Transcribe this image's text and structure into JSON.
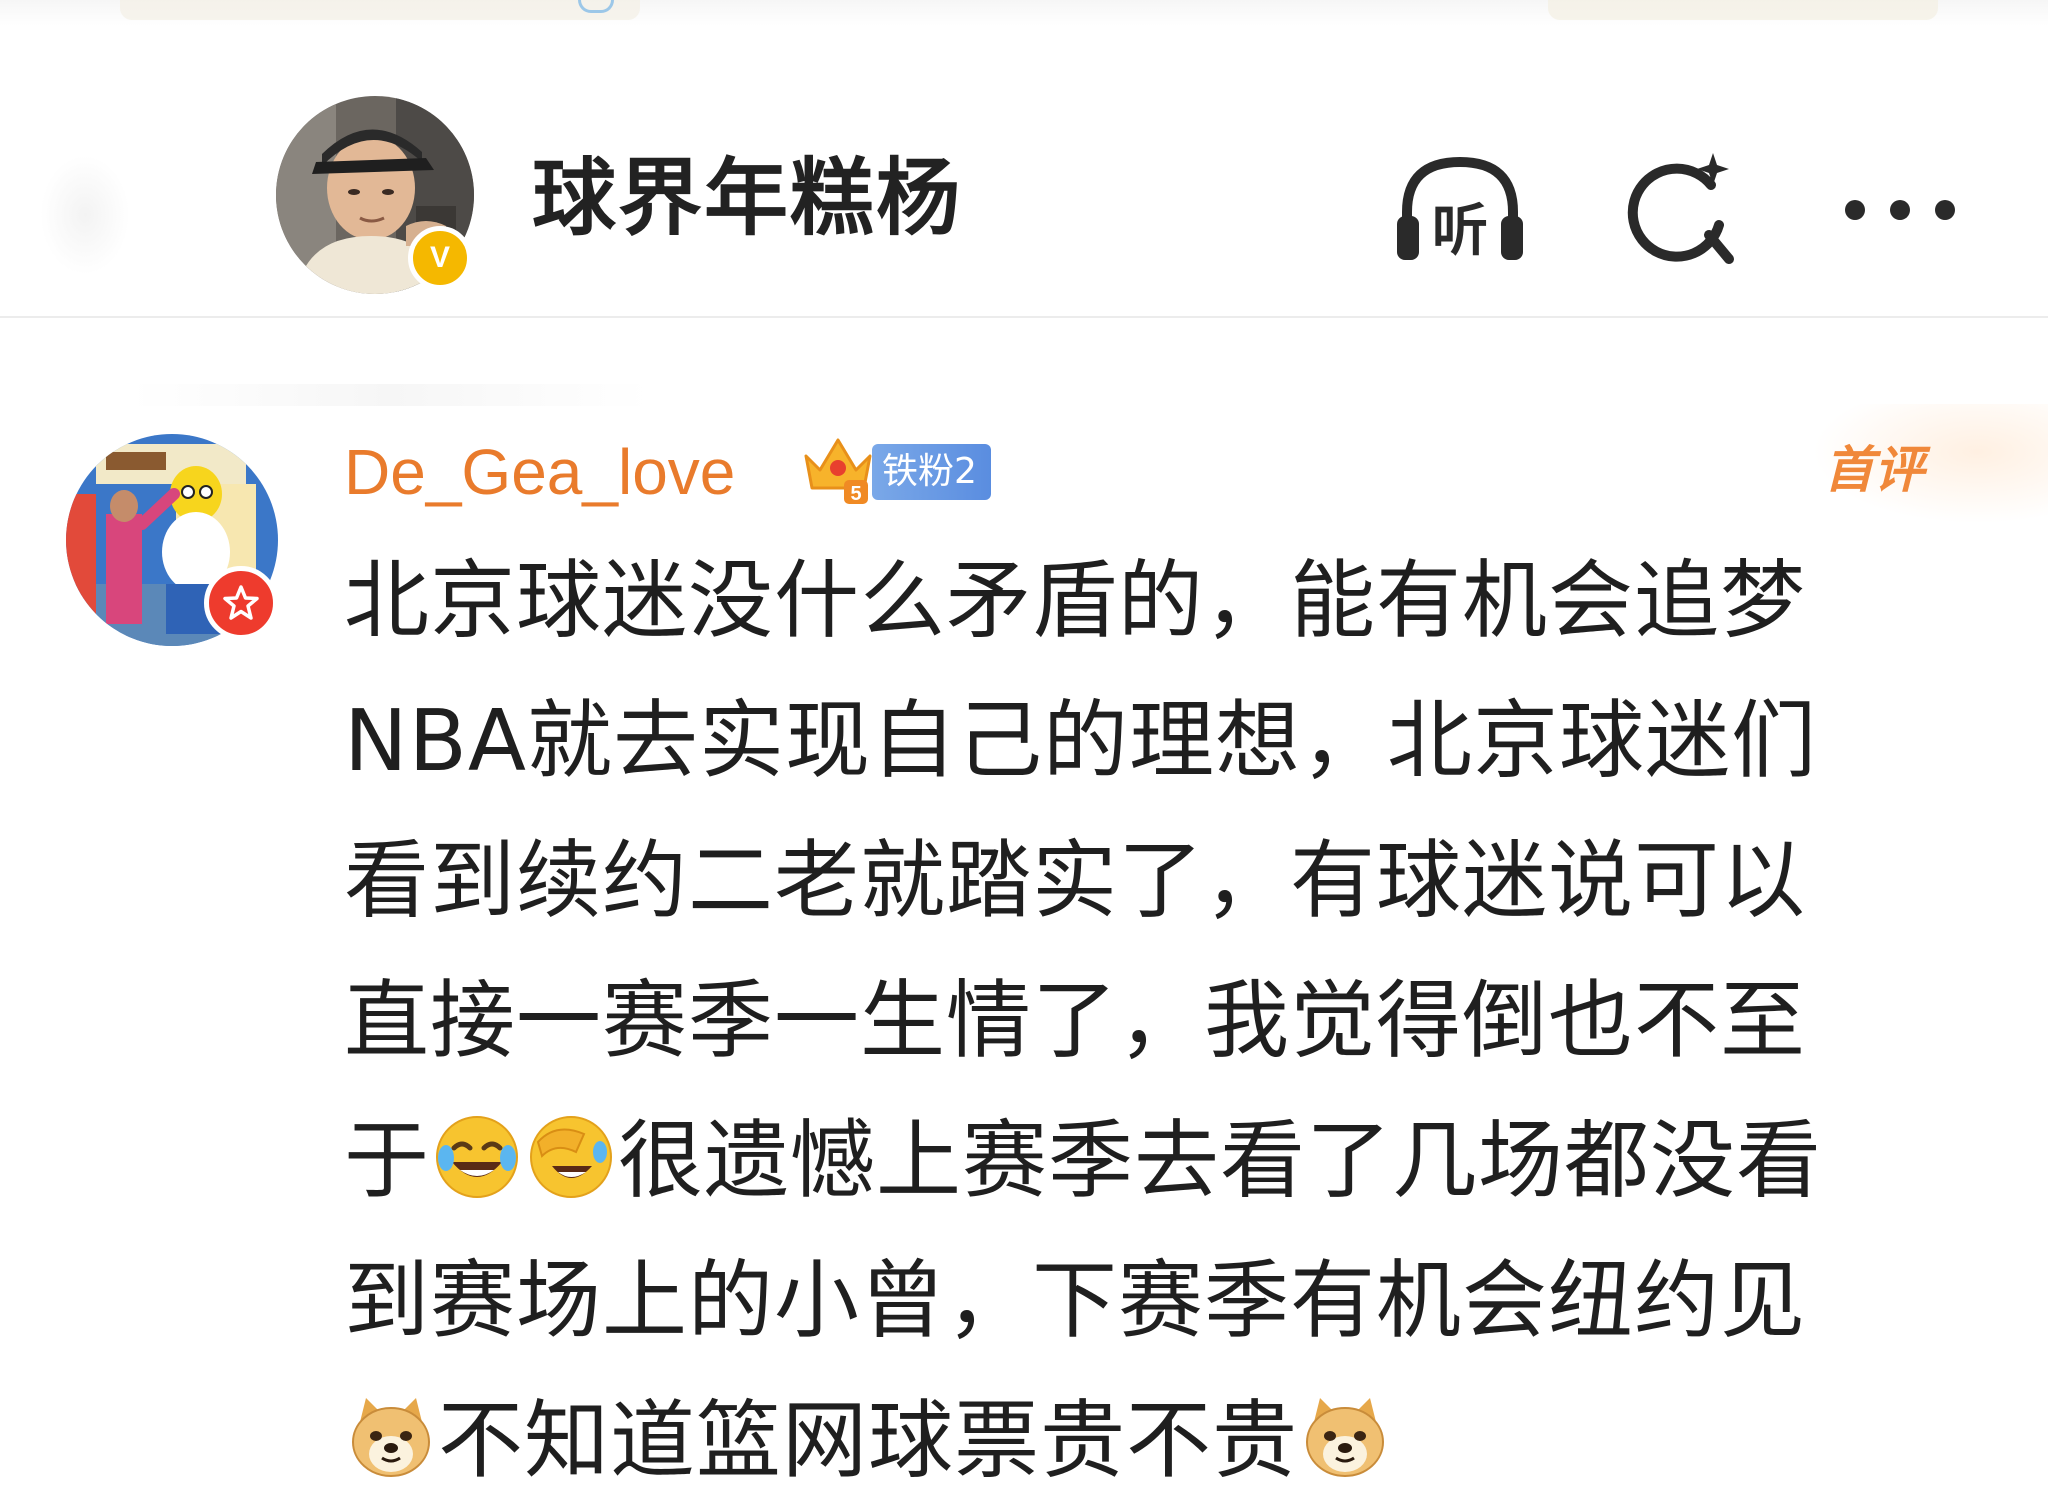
{
  "header": {
    "title": "球界年糕杨",
    "verified_mark": "V",
    "listen_label": "听",
    "icons": [
      "listen-icon",
      "search-icon",
      "more-icon"
    ]
  },
  "comment": {
    "username": "De_Gea_love",
    "crown_level": "5",
    "fan_badge": "铁粉2",
    "first_comment_tag": "首评",
    "lines": [
      [
        "北京球迷没什么矛盾的，能有机会追梦"
      ],
      [
        "NBA就去实现自己的理想，北京球迷们"
      ],
      [
        "看到续约二老就踏实了，有球迷说可以"
      ],
      [
        "直接一赛季一生情了，我觉得倒也不至"
      ],
      [
        "于",
        "很遗憾上赛季去看了几场都没看"
      ],
      [
        "到赛场上的小曾，下赛季有机会纽约见"
      ],
      [
        "不知道篮网球票贵不贵"
      ]
    ],
    "emojis": [
      "laughing-crying-emoji",
      "facepalm-laugh-emoji",
      "doge-emoji",
      "doge-emoji"
    ]
  },
  "colors": {
    "username": "#e97b2c",
    "first_comment": "#f0883a",
    "verified": "#f5b800",
    "star_badge": "#ee3b2d",
    "fan_badge": "#5a8de0"
  }
}
